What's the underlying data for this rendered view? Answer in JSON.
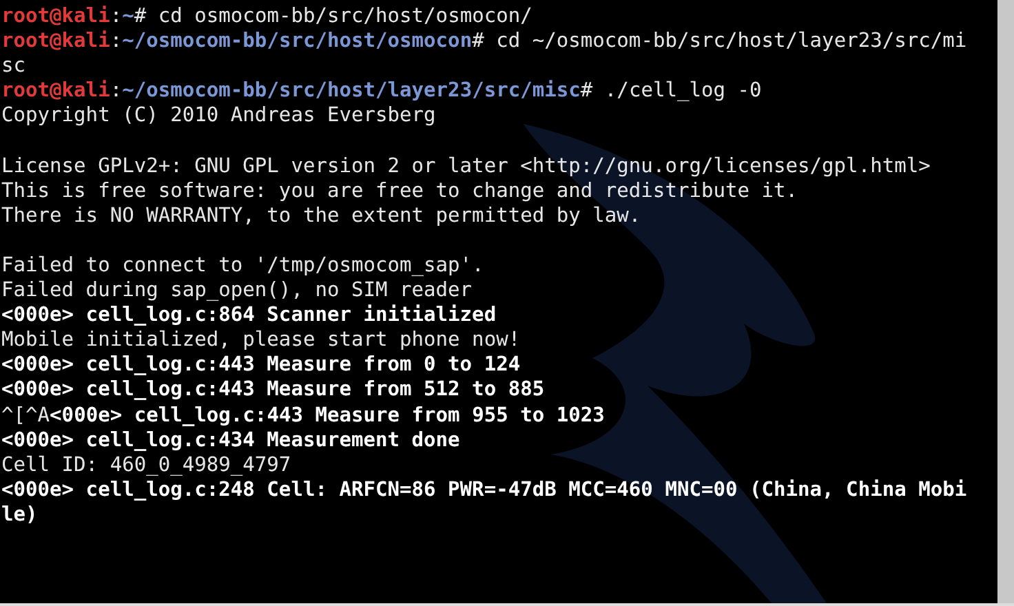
{
  "terminal": {
    "lines": [
      {
        "kind": "text",
        "segments": [
          {
            "kind": "user",
            "text": "root@kali"
          },
          {
            "kind": "plain",
            "text": ":"
          },
          {
            "kind": "path",
            "text": "~"
          },
          {
            "kind": "plain",
            "text": "# cd osmocom-bb/src/host/osmocon/"
          }
        ]
      },
      {
        "kind": "text",
        "segments": [
          {
            "kind": "user",
            "text": "root@kali"
          },
          {
            "kind": "plain",
            "text": ":"
          },
          {
            "kind": "path",
            "text": "~/osmocom-bb/src/host/osmocon"
          },
          {
            "kind": "plain",
            "text": "# cd ~/osmocom-bb/src/host/layer23/src/mi"
          }
        ]
      },
      {
        "kind": "text",
        "segments": [
          {
            "kind": "plain",
            "text": "sc"
          }
        ]
      },
      {
        "kind": "text",
        "segments": [
          {
            "kind": "user",
            "text": "root@kali"
          },
          {
            "kind": "plain",
            "text": ":"
          },
          {
            "kind": "path",
            "text": "~/osmocom-bb/src/host/layer23/src/misc"
          },
          {
            "kind": "plain",
            "text": "# ./cell_log -0"
          }
        ]
      },
      {
        "kind": "text",
        "segments": [
          {
            "kind": "plain",
            "text": "Copyright (C) 2010 Andreas Eversberg"
          }
        ]
      },
      {
        "kind": "blank"
      },
      {
        "kind": "text",
        "segments": [
          {
            "kind": "plain",
            "text": "License GPLv2+: GNU GPL version 2 or later <http://gnu.org/licenses/gpl.html>"
          }
        ]
      },
      {
        "kind": "text",
        "segments": [
          {
            "kind": "plain",
            "text": "This is free software: you are free to change and redistribute it."
          }
        ]
      },
      {
        "kind": "text",
        "segments": [
          {
            "kind": "plain",
            "text": "There is NO WARRANTY, to the extent permitted by law."
          }
        ]
      },
      {
        "kind": "blank"
      },
      {
        "kind": "text",
        "segments": [
          {
            "kind": "plain",
            "text": "Failed to connect to '/tmp/osmocom_sap'."
          }
        ]
      },
      {
        "kind": "text",
        "segments": [
          {
            "kind": "plain",
            "text": "Failed during sap_open(), no SIM reader"
          }
        ]
      },
      {
        "kind": "text",
        "segments": [
          {
            "kind": "bold",
            "text": "<000e> cell_log.c:864 Scanner initialized"
          }
        ]
      },
      {
        "kind": "text",
        "segments": [
          {
            "kind": "plain",
            "text": "Mobile initialized, please start phone now!"
          }
        ]
      },
      {
        "kind": "text",
        "segments": [
          {
            "kind": "bold",
            "text": "<000e> cell_log.c:443 Measure from 0 to 124"
          }
        ]
      },
      {
        "kind": "text",
        "segments": [
          {
            "kind": "bold",
            "text": "<000e> cell_log.c:443 Measure from 512 to 885"
          }
        ]
      },
      {
        "kind": "text",
        "segments": [
          {
            "kind": "plain",
            "text": "^[^A"
          },
          {
            "kind": "bold",
            "text": "<000e> cell_log.c:443 Measure from 955 to 1023"
          }
        ]
      },
      {
        "kind": "text",
        "segments": [
          {
            "kind": "bold",
            "text": "<000e> cell_log.c:434 Measurement done"
          }
        ]
      },
      {
        "kind": "text",
        "segments": [
          {
            "kind": "plain",
            "text": "Cell ID: 460_0_4989_4797"
          }
        ]
      },
      {
        "kind": "text",
        "segments": [
          {
            "kind": "bold",
            "text": "<000e> cell_log.c:248 Cell: ARFCN=86 PWR=-47dB MCC=460 MNC=00 (China, China Mobi"
          }
        ]
      },
      {
        "kind": "text",
        "segments": [
          {
            "kind": "bold",
            "text": "le)"
          }
        ]
      }
    ]
  }
}
